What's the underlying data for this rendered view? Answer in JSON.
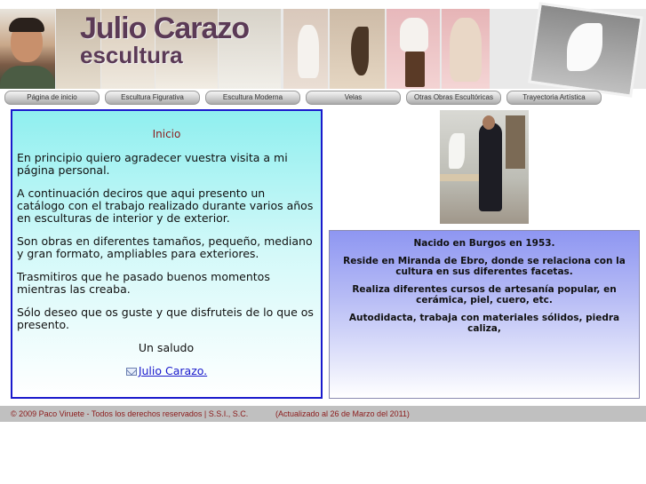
{
  "header": {
    "title": "Julio Carazo",
    "subtitle": "escultura"
  },
  "nav": {
    "items": [
      {
        "label": "Página de inicio"
      },
      {
        "label": "Escultura Figurativa"
      },
      {
        "label": "Escultura Moderna"
      },
      {
        "label": "Velas"
      },
      {
        "label": "Otras Obras Escultóricas"
      },
      {
        "label": "Trayectoria Artística"
      }
    ]
  },
  "main": {
    "heading": "Inicio",
    "paragraphs": [
      "En principio quiero agradecer vuestra visita a mi página personal.",
      "A continuación deciros que aqui presento un catálogo con el trabajo realizado durante varios años en esculturas de interior y de exterior.",
      "Son obras en diferentes tamaños, pequeño, mediano y gran formato, ampliables para exteriores.",
      "Trasmitiros que he pasado buenos momentos mientras las creaba.",
      "Sólo deseo que os guste y que disfruteis de lo que os presento."
    ],
    "greeting": "Un saludo",
    "signature": "Julio Carazo."
  },
  "bio": {
    "lines": [
      "Nacido en Burgos en 1953.",
      "Reside en Miranda de Ebro, donde se relaciona con la cultura en sus diferentes facetas.",
      "Realiza diferentes cursos de artesanía popular, en cerámica, piel, cuero, etc.",
      "Autodidacta, trabaja con materiales sólidos, piedra caliza,"
    ]
  },
  "footer": {
    "copyright": "© 2009 Paco Viruete - Todos los derechos reservados | S.S.I., S.C.",
    "updated": "(Actualizado al  26 de Marzo del 2011)"
  },
  "colors": {
    "title": "#5b3a56",
    "heading": "#8b1a1a",
    "box_border": "#1a1acc",
    "footer_bg": "#c0c0c0",
    "footer_text": "#8b1a1a"
  }
}
